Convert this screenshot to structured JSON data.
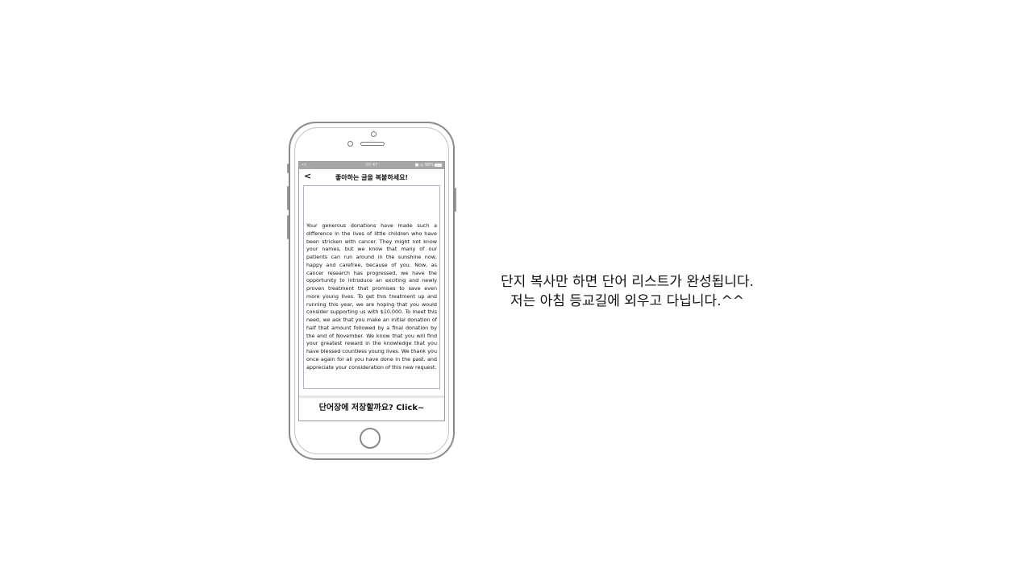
{
  "status_bar": {
    "signal": "•ıl",
    "time": "07:47",
    "icons": "■ ◎ 98%"
  },
  "nav": {
    "back_label": "<",
    "title": "좋아하는 글을 복붙하세요!"
  },
  "passage": "Your generous donations have made such a difference in the lives of little children who have been stricken with cancer. They might not know your names, but we know that many of our patients can run around in the sunshine now, happy and carefree, because of you. Now, as cancer research has progressed, we have the opportunity to introduce an exciting and newly proven treatment that promises to save even more young lives. To get this treatment up and running this year, we are hoping that you would consider supporting us with $10,000. To meet this need, we ask that you make an initial donation of half that amount followed by a final donation by the end of November. We know that you will find your greatest reward in the knowledge that you have blessed countless young lives. We thank you once again for all you have done in the past, and appreciate your consideration of this new request.",
  "save_button": "단어장에 저장할까요? Click~",
  "caption": {
    "line1": "단지 복사만 하면 단어 리스트가 완성됩니다.",
    "line2": "저는 아침 등교길에 외우고 다닙니다.^^"
  }
}
